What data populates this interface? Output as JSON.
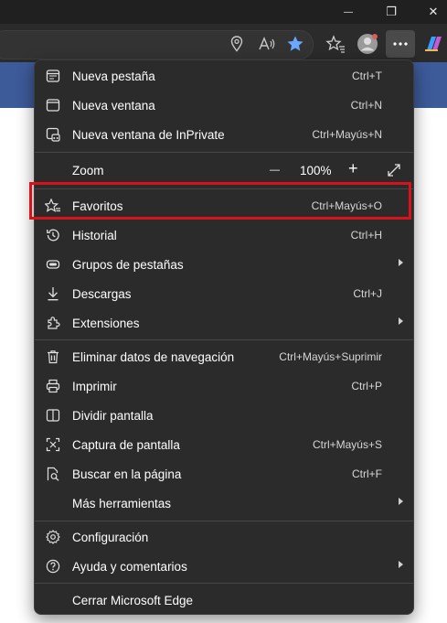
{
  "browser": {
    "window_controls": {
      "minimize": "—",
      "restore": "❐",
      "close": "✕"
    }
  },
  "menu": {
    "items_group1": [
      {
        "label": "Nueva pestaña",
        "shortcut": "Ctrl+T",
        "icon": "new-tab-icon"
      },
      {
        "label": "Nueva ventana",
        "shortcut": "Ctrl+N",
        "icon": "new-window-icon"
      },
      {
        "label": "Nueva ventana de InPrivate",
        "shortcut": "Ctrl+Mayús+N",
        "icon": "inprivate-icon"
      }
    ],
    "zoom": {
      "label": "Zoom",
      "minus": "—",
      "value": "100%",
      "plus": "+"
    },
    "items_group2": [
      {
        "label": "Favoritos",
        "shortcut": "Ctrl+Mayús+O",
        "icon": "favorites-icon"
      },
      {
        "label": "Historial",
        "shortcut": "Ctrl+H",
        "icon": "history-icon"
      },
      {
        "label": "Grupos de pestañas",
        "shortcut": "",
        "icon": "tab-groups-icon",
        "submenu": true
      },
      {
        "label": "Descargas",
        "shortcut": "Ctrl+J",
        "icon": "download-icon"
      },
      {
        "label": "Extensiones",
        "shortcut": "",
        "icon": "extensions-icon",
        "submenu": true
      }
    ],
    "items_group3": [
      {
        "label": "Eliminar datos de navegación",
        "shortcut": "Ctrl+Mayús+Suprimir",
        "icon": "trash-icon"
      },
      {
        "label": "Imprimir",
        "shortcut": "Ctrl+P",
        "icon": "printer-icon"
      },
      {
        "label": "Dividir pantalla",
        "shortcut": "",
        "icon": "split-screen-icon"
      },
      {
        "label": "Captura de pantalla",
        "shortcut": "Ctrl+Mayús+S",
        "icon": "screenshot-icon"
      },
      {
        "label": "Buscar en la página",
        "shortcut": "Ctrl+F",
        "icon": "find-icon"
      },
      {
        "label": "Más herramientas",
        "shortcut": "",
        "icon": "",
        "submenu": true
      }
    ],
    "items_group4": [
      {
        "label": "Configuración",
        "shortcut": "",
        "icon": "settings-icon"
      },
      {
        "label": "Ayuda y comentarios",
        "shortcut": "",
        "icon": "help-icon",
        "submenu": true
      }
    ],
    "close": {
      "label": "Cerrar Microsoft Edge"
    }
  },
  "colors": {
    "menu_bg": "#2b2b2b",
    "highlight_border": "#d8121a",
    "page_banner": "#3d5a99",
    "favorite_star": "#6aa8ff"
  }
}
